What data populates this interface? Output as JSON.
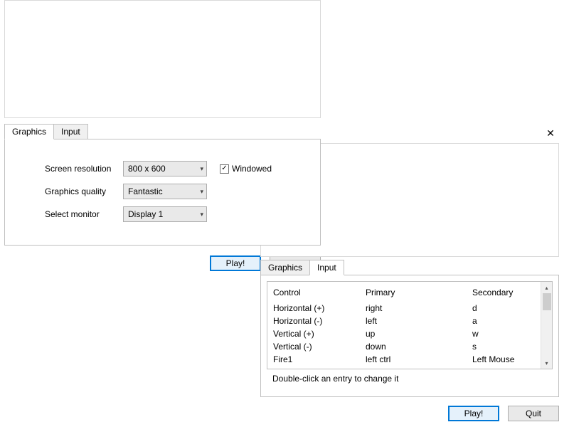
{
  "tabs": {
    "graphics": "Graphics",
    "input": "Input"
  },
  "graphics": {
    "resolution_label": "Screen resolution",
    "resolution_value": "800 x 600",
    "windowed_label": "Windowed",
    "windowed_checked": true,
    "quality_label": "Graphics quality",
    "quality_value": "Fantastic",
    "monitor_label": "Select monitor",
    "monitor_value": "Display 1"
  },
  "input": {
    "columns": {
      "control": "Control",
      "primary": "Primary",
      "secondary": "Secondary"
    },
    "rows": [
      {
        "control": "Horizontal (+)",
        "primary": "right",
        "secondary": "d"
      },
      {
        "control": "Horizontal (-)",
        "primary": "left",
        "secondary": "a"
      },
      {
        "control": "Vertical (+)",
        "primary": "up",
        "secondary": "w"
      },
      {
        "control": "Vertical (-)",
        "primary": "down",
        "secondary": "s"
      },
      {
        "control": "Fire1",
        "primary": "left ctrl",
        "secondary": "Left Mouse"
      }
    ],
    "hint": "Double-click an entry to change it"
  },
  "buttons": {
    "play": "Play!",
    "quit": "Quit"
  }
}
